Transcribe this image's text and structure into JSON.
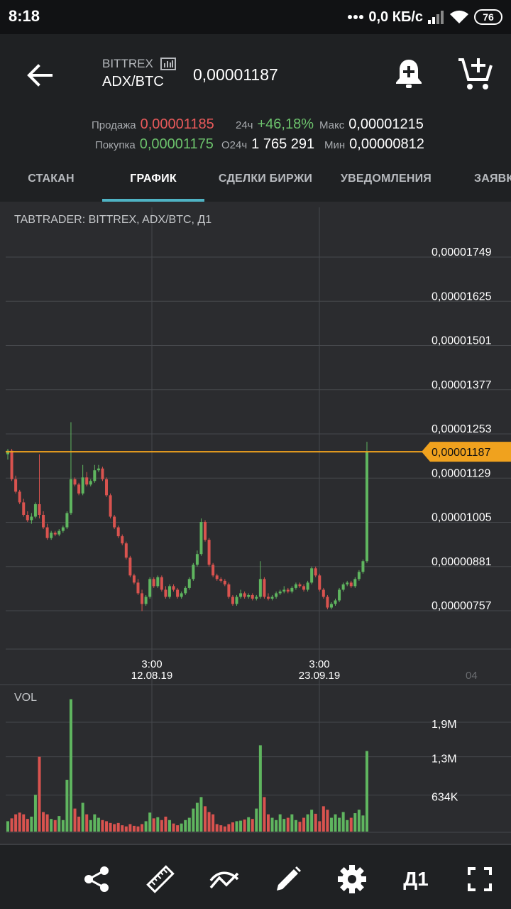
{
  "status_bar": {
    "time": "8:18",
    "speed": "0,0 КБ/с",
    "battery": "76"
  },
  "header": {
    "exchange": "BITTREX",
    "pair": "ADX/BTC",
    "last_price": "0,00001187"
  },
  "stats": {
    "sell_label": "Продажа",
    "sell_value": "0,00001185",
    "buy_label": "Покупка",
    "buy_value": "0,00001175",
    "change_label": "24ч",
    "change_value": "+46,18%",
    "volume_label": "O24ч",
    "volume_value": "1 765 291",
    "max_label": "Макс",
    "max_value": "0,00001215",
    "min_label": "Мин",
    "min_value": "0,00000812"
  },
  "tabs": [
    {
      "label": "СТАКАН"
    },
    {
      "label": "ГРАФИК"
    },
    {
      "label": "СДЕЛКИ БИРЖИ"
    },
    {
      "label": "УВЕДОМЛЕНИЯ"
    },
    {
      "label": "ЗАЯВК"
    }
  ],
  "chart": {
    "title": "TABTRADER: BITTREX, ADX/BTC, Д1",
    "vol_label": "VOL",
    "timeframe": "Д1",
    "x_labels": [
      {
        "time": "3:00",
        "date": "12.08.19"
      },
      {
        "time": "3:00",
        "date": "23.09.19"
      }
    ],
    "x_cut_label": "04"
  },
  "chart_data": {
    "type": "candlestick",
    "title": "TABTRADER: BITTREX, ADX/BTC, Д1",
    "y_ticks": [
      "0,00001749",
      "0,00001625",
      "0,00001501",
      "0,00001377",
      "0,00001253",
      "0,00001129",
      "0,00001005",
      "0,00000881",
      "0,00000757"
    ],
    "y_tick_values": [
      1.749e-05,
      1.625e-05,
      1.501e-05,
      1.377e-05,
      1.253e-05,
      1.129e-05,
      1.005e-05,
      8.81e-06,
      7.57e-06
    ],
    "price_marker": "0,00001187",
    "price_marker_value": 1.187e-05,
    "volume_ticks": [
      "1,9M",
      "1,3M",
      "634K"
    ],
    "volume_tick_values": [
      1900000,
      1300000,
      634000
    ],
    "colors": {
      "up": "#5fb55f",
      "down": "#d9534f",
      "marker": "#f0a21e",
      "grid": "#46484c"
    },
    "candles": [
      [
        1.18e-05,
        1.19e-05,
        1.165e-05,
        1.195e-05,
        180000
      ],
      [
        1.19e-05,
        1.11e-05,
        1.195e-05,
        1.105e-05,
        230000
      ],
      [
        1.11e-05,
        1.075e-05,
        1.12e-05,
        1.07e-05,
        300000
      ],
      [
        1.075e-05,
        1.045e-05,
        1.08e-05,
        1.04e-05,
        330000
      ],
      [
        1.045e-05,
        1.01e-05,
        1.055e-05,
        1.005e-05,
        300000
      ],
      [
        1.01e-05,
        9.95e-06,
        1.02e-05,
        9.9e-06,
        220000
      ],
      [
        9.95e-06,
        1.005e-05,
        9.85e-06,
        1.015e-05,
        260000
      ],
      [
        1.005e-05,
        1.04e-05,
        1e-05,
        1.045e-05,
        640000
      ],
      [
        1.04e-05,
        1.01e-05,
        1.18e-05,
        1e-05,
        1300000
      ],
      [
        1.01e-05,
        9.75e-06,
        1.02e-05,
        9.7e-06,
        340000
      ],
      [
        9.75e-06,
        9.45e-06,
        9.85e-06,
        9.4e-06,
        300000
      ],
      [
        9.45e-06,
        9.6e-06,
        9.4e-06,
        9.65e-06,
        220000
      ],
      [
        9.6e-06,
        9.55e-06,
        9.65e-06,
        9.5e-06,
        200000
      ],
      [
        9.55e-06,
        9.65e-06,
        9.5e-06,
        9.7e-06,
        270000
      ],
      [
        9.65e-06,
        9.75e-06,
        9.6e-06,
        9.8e-06,
        200000
      ],
      [
        9.75e-06,
        1.015e-05,
        9.7e-06,
        1.02e-05,
        900000
      ],
      [
        1.015e-05,
        1.11e-05,
        1.01e-05,
        1.27e-05,
        2300000
      ],
      [
        1.11e-05,
        1.095e-05,
        1.115e-05,
        1.09e-05,
        400000
      ],
      [
        1.095e-05,
        1.07e-05,
        1.1e-05,
        1.065e-05,
        260000
      ],
      [
        1.07e-05,
        1.115e-05,
        1.065e-05,
        1.15e-05,
        500000
      ],
      [
        1.115e-05,
        1.095e-05,
        1.13e-05,
        1.09e-05,
        300000
      ],
      [
        1.095e-05,
        1.105e-05,
        1.09e-05,
        1.11e-05,
        200000
      ],
      [
        1.105e-05,
        1.135e-05,
        1.1e-05,
        1.15e-05,
        300000
      ],
      [
        1.135e-05,
        1.14e-05,
        1.13e-05,
        1.15e-05,
        240000
      ],
      [
        1.14e-05,
        1.11e-05,
        1.145e-05,
        1.105e-05,
        200000
      ],
      [
        1.11e-05,
        1.065e-05,
        1.115e-05,
        1.06e-05,
        180000
      ],
      [
        1.065e-05,
        1.005e-05,
        1.07e-05,
        1e-05,
        150000
      ],
      [
        1.005e-05,
        9.75e-06,
        1.01e-05,
        9.7e-06,
        130000
      ],
      [
        9.75e-06,
        9.5e-06,
        9.8e-06,
        9.45e-06,
        150000
      ],
      [
        9.5e-06,
        9.3e-06,
        9.55e-06,
        9.25e-06,
        110000
      ],
      [
        9.3e-06,
        8.9e-06,
        9.35e-06,
        8.85e-06,
        90000
      ],
      [
        8.9e-06,
        8.4e-06,
        8.95e-06,
        8.35e-06,
        130000
      ],
      [
        8.4e-06,
        8.2e-06,
        8.45e-06,
        8.15e-06,
        100000
      ],
      [
        8.2e-06,
        7.9e-06,
        8.3e-06,
        7.85e-06,
        90000
      ],
      [
        7.9e-06,
        7.6e-06,
        8e-06,
        7.4e-06,
        130000
      ],
      [
        7.6e-06,
        7.8e-06,
        7.55e-06,
        7.85e-06,
        180000
      ],
      [
        7.8e-06,
        8.3e-06,
        7.75e-06,
        8.35e-06,
        330000
      ],
      [
        8.3e-06,
        8.1e-06,
        8.35e-06,
        8.05e-06,
        230000
      ],
      [
        8.1e-06,
        8.35e-06,
        8.05e-06,
        8.4e-06,
        250000
      ],
      [
        8.35e-06,
        8e-06,
        8.4e-06,
        7.95e-06,
        200000
      ],
      [
        8e-06,
        7.8e-06,
        8.1e-06,
        7.75e-06,
        260000
      ],
      [
        7.8e-06,
        8.1e-06,
        7.75e-06,
        8.15e-06,
        200000
      ],
      [
        8.1e-06,
        8e-06,
        8.15e-06,
        7.95e-06,
        140000
      ],
      [
        8e-06,
        7.8e-06,
        8.05e-06,
        7.75e-06,
        110000
      ],
      [
        7.8e-06,
        7.9e-06,
        7.75e-06,
        7.95e-06,
        140000
      ],
      [
        7.9e-06,
        8.05e-06,
        7.85e-06,
        8.1e-06,
        200000
      ],
      [
        8.05e-06,
        8.3e-06,
        8e-06,
        8.35e-06,
        240000
      ],
      [
        8.3e-06,
        8.7e-06,
        8.25e-06,
        8.75e-06,
        400000
      ],
      [
        8.7e-06,
        9e-06,
        8.65e-06,
        9.1e-06,
        500000
      ],
      [
        9e-06,
        9.9e-06,
        8.95e-06,
        1e-05,
        600000
      ],
      [
        9.9e-06,
        9.4e-06,
        9.95e-06,
        9.35e-06,
        440000
      ],
      [
        9.4e-06,
        8.7e-06,
        9.45e-06,
        8.65e-06,
        340000
      ],
      [
        8.7e-06,
        8.4e-06,
        8.75e-06,
        8.35e-06,
        300000
      ],
      [
        8.4e-06,
        8.3e-06,
        8.45e-06,
        8.25e-06,
        130000
      ],
      [
        8.3e-06,
        8.25e-06,
        8.35e-06,
        8.2e-06,
        110000
      ],
      [
        8.25e-06,
        8.15e-06,
        8.3e-06,
        8.1e-06,
        90000
      ],
      [
        8.15e-06,
        7.8e-06,
        8.2e-06,
        7.75e-06,
        130000
      ],
      [
        7.8e-06,
        7.6e-06,
        7.85e-06,
        7.55e-06,
        160000
      ],
      [
        7.6e-06,
        7.8e-06,
        7.55e-06,
        7.85e-06,
        180000
      ],
      [
        7.8e-06,
        7.9e-06,
        7.75e-06,
        8e-06,
        190000
      ],
      [
        7.9e-06,
        7.8e-06,
        7.95e-06,
        7.75e-06,
        210000
      ],
      [
        7.8e-06,
        7.85e-06,
        7.75e-06,
        7.9e-06,
        250000
      ],
      [
        7.85e-06,
        7.75e-06,
        7.9e-06,
        7.7e-06,
        220000
      ],
      [
        7.75e-06,
        7.8e-06,
        7.7e-06,
        7.85e-06,
        400000
      ],
      [
        7.8e-06,
        8.3e-06,
        7.75e-06,
        8.8e-06,
        1500000
      ],
      [
        8.3e-06,
        7.8e-06,
        8.35e-06,
        7.75e-06,
        600000
      ],
      [
        7.8e-06,
        7.75e-06,
        7.9e-06,
        7.7e-06,
        300000
      ],
      [
        7.75e-06,
        7.8e-06,
        7.7e-06,
        7.85e-06,
        240000
      ],
      [
        7.8e-06,
        7.9e-06,
        7.75e-06,
        7.95e-06,
        200000
      ],
      [
        7.9e-06,
        7.95e-06,
        7.85e-06,
        8e-06,
        300000
      ],
      [
        7.95e-06,
        8e-06,
        7.9e-06,
        8.1e-06,
        220000
      ],
      [
        8e-06,
        7.95e-06,
        8.05e-06,
        7.9e-06,
        240000
      ],
      [
        7.95e-06,
        8.05e-06,
        7.9e-06,
        8.1e-06,
        300000
      ],
      [
        8.05e-06,
        8.15e-06,
        8e-06,
        8.2e-06,
        200000
      ],
      [
        8.15e-06,
        8.1e-06,
        8.2e-06,
        8.05e-06,
        170000
      ],
      [
        8.1e-06,
        8e-06,
        8.15e-06,
        7.95e-06,
        240000
      ],
      [
        8e-06,
        8.2e-06,
        7.95e-06,
        8.25e-06,
        300000
      ],
      [
        8.2e-06,
        8.6e-06,
        8.15e-06,
        8.65e-06,
        380000
      ],
      [
        8.6e-06,
        8.4e-06,
        8.65e-06,
        8.35e-06,
        310000
      ],
      [
        8.4e-06,
        8e-06,
        8.45e-06,
        7.95e-06,
        180000
      ],
      [
        8e-06,
        7.8e-06,
        8.05e-06,
        7.75e-06,
        440000
      ],
      [
        7.8e-06,
        7.5e-06,
        7.85e-06,
        7.45e-06,
        380000
      ],
      [
        7.5e-06,
        7.6e-06,
        7.45e-06,
        7.65e-06,
        240000
      ],
      [
        7.6e-06,
        7.7e-06,
        7.55e-06,
        7.75e-06,
        300000
      ],
      [
        7.7e-06,
        8e-06,
        7.65e-06,
        8.05e-06,
        240000
      ],
      [
        8e-06,
        8.15e-06,
        7.95e-06,
        8.2e-06,
        340000
      ],
      [
        8.15e-06,
        8.2e-06,
        8.1e-06,
        8.25e-06,
        200000
      ],
      [
        8.2e-06,
        8.1e-06,
        8.25e-06,
        8.05e-06,
        240000
      ],
      [
        8.1e-06,
        8.3e-06,
        8.05e-06,
        8.35e-06,
        320000
      ],
      [
        8.3e-06,
        8.5e-06,
        8.25e-06,
        8.55e-06,
        380000
      ],
      [
        8.5e-06,
        8.8e-06,
        8.45e-06,
        8.85e-06,
        280000
      ],
      [
        8.8e-06,
        1.187e-05,
        8.75e-06,
        1.215e-05,
        1400000
      ]
    ]
  }
}
